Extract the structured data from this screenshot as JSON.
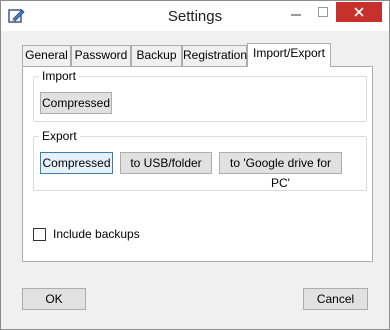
{
  "window": {
    "title": "Settings",
    "app_icon": "settings-app-icon",
    "controls": [
      "minimize-icon",
      "maximize-icon",
      "close-icon"
    ]
  },
  "tabs": [
    {
      "label": "General",
      "active": false
    },
    {
      "label": "Password",
      "active": false
    },
    {
      "label": "Backup",
      "active": false
    },
    {
      "label": "Registration",
      "active": false
    },
    {
      "label": "Import/Export",
      "active": true
    }
  ],
  "import_group": {
    "label": "Import",
    "compressed_button": "Compressed"
  },
  "export_group": {
    "label": "Export",
    "compressed_button": "Compressed",
    "usb_button": "to USB/folder",
    "gdrive_button": "to 'Google drive for PC'"
  },
  "include_backups": {
    "label": "Include backups",
    "checked": false
  },
  "footer": {
    "ok_label": "OK",
    "cancel_label": "Cancel"
  },
  "colors": {
    "close_button": "#c7302b",
    "focus_border": "#3c7fb1",
    "focus_fill": "#e5f1fb"
  }
}
